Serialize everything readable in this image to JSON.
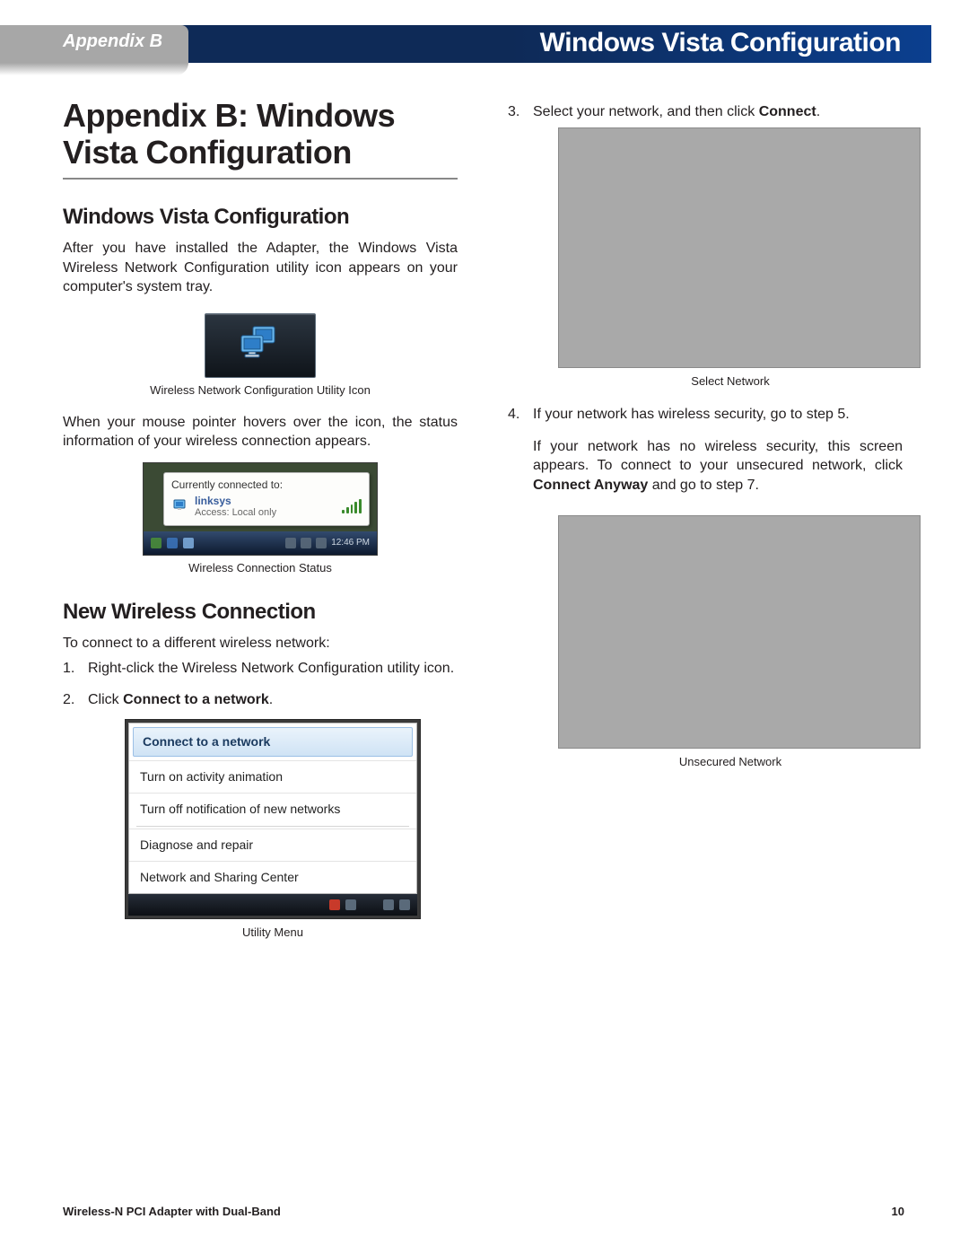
{
  "header": {
    "left": "Appendix B",
    "right": "Windows Vista Configuration"
  },
  "left_col": {
    "h1": "Appendix B: Windows Vista Configuration",
    "h2_1": "Windows Vista Configuration",
    "p1": "After you have installed the Adapter, the Windows Vista Wireless Network Configuration utility icon appears on your computer's system tray.",
    "cap1": "Wireless Network Configuration Utility Icon",
    "p2": "When your mouse pointer hovers over the icon, the status information of your wireless connection appears.",
    "status": {
      "hdr": "Currently connected to:",
      "net": "linksys",
      "access": "Access:  Local only",
      "time": "12:46 PM"
    },
    "cap2": "Wireless Connection Status",
    "h2_2": "New Wireless Connection",
    "p3": "To connect to a different wireless network:",
    "step1": "Right-click the Wireless Network Configuration utility icon.",
    "step2_a": "Click ",
    "step2_b": "Connect to a network",
    "step2_c": ".",
    "menu": {
      "m1": "Connect to a network",
      "m2": "Turn on activity animation",
      "m3": "Turn off notification of new networks",
      "m4": "Diagnose and repair",
      "m5": "Network and Sharing Center"
    },
    "cap3": "Utility Menu"
  },
  "right_col": {
    "step3_a": "Select your network, and then click ",
    "step3_b": "Connect",
    "step3_c": ".",
    "cap4": "Select Network",
    "step4_l1": "If your network has wireless security, go to step 5.",
    "step4_l2a": "If your network has no wireless security, this screen appears. To connect to your unsecured network, click ",
    "step4_l2b": "Connect Anyway",
    "step4_l2c": " and go to step 7.",
    "cap5": "Unsecured Network"
  },
  "footer": {
    "product": "Wireless-N PCI Adapter with Dual-Band",
    "page": "10"
  }
}
